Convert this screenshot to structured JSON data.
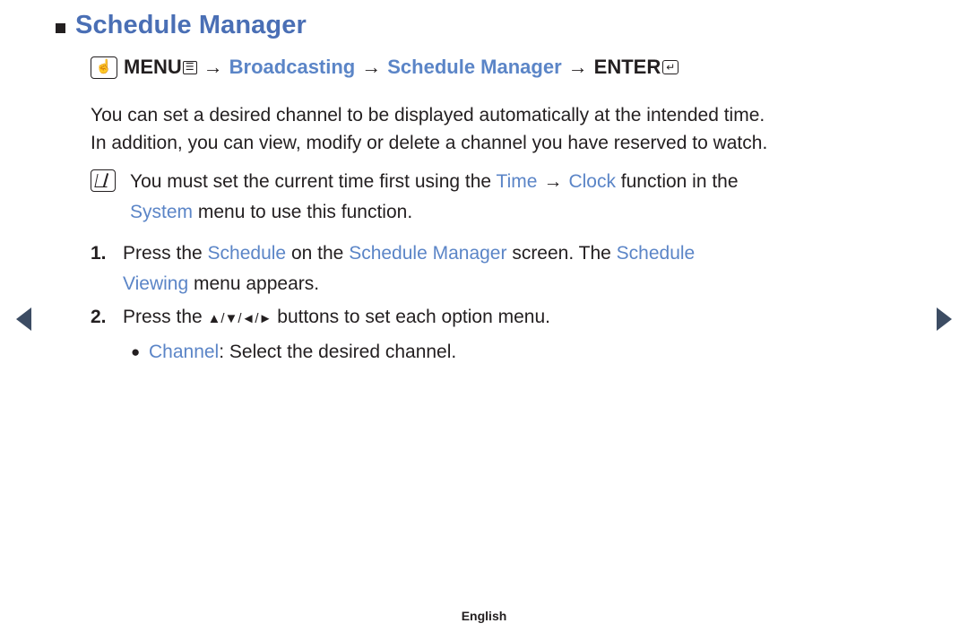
{
  "title": {
    "text": "Schedule Manager",
    "bullet": "square-bullet"
  },
  "menu_path": {
    "icon": "hand-press-icon",
    "menu_label": "MENU",
    "menu_box_glyph": "☰",
    "arrow1": "→",
    "broadcasting_label": "Broadcasting",
    "arrow2": "→",
    "schedule_manager_label": "Schedule Manager",
    "arrow3": "→",
    "enter_label": "ENTER",
    "enter_glyph": "↵"
  },
  "intro": {
    "line1": "You can set a desired channel to be displayed automatically at the intended time.",
    "line2": "In addition, you can view, modify or delete a channel you have reserved to watch."
  },
  "note": {
    "icon": "note-pencil-icon",
    "part1": "You must set the current time first using the ",
    "time_label": "Time",
    "arrow": "→",
    "clock_label": "Clock",
    "part2": " function in the",
    "system_label": "System",
    "part3": " menu to use this function."
  },
  "steps": [
    {
      "num": "1.",
      "part1": "Press the ",
      "kw1": "Schedule",
      "part2": " on the ",
      "kw2": "Schedule Manager",
      "part3": " screen. The ",
      "kw3": "Schedule",
      "kw4": "Viewing",
      "part4": " menu appears."
    },
    {
      "num": "2.",
      "part1": "Press the ",
      "directions": "▲/▼/◄/►",
      "part2": " buttons to set each option menu."
    }
  ],
  "sub_item": {
    "bullet": "●",
    "label": "Channel",
    "text": ": Select the desired channel."
  },
  "nav": {
    "prev": "prev-page-arrow",
    "next": "next-page-arrow"
  },
  "footer": {
    "language": "English"
  },
  "colors": {
    "accent_blue": "#5b85c7",
    "title_blue": "#4a6fb5",
    "text": "#231f20",
    "nav_arrow": "#3c4c63"
  }
}
